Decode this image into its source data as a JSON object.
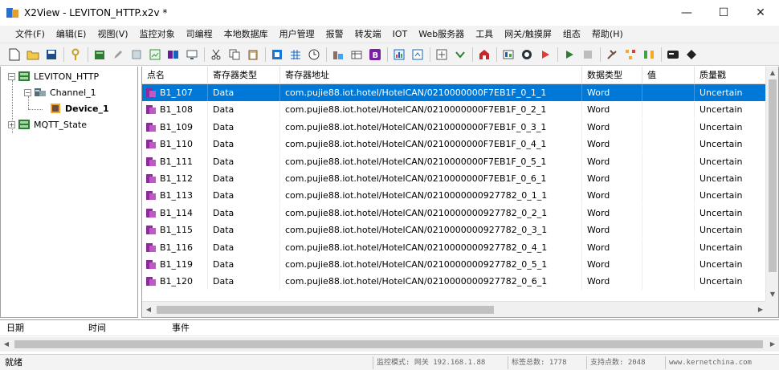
{
  "window": {
    "title": "X2View - LEVITON_HTTP.x2v *",
    "minimize_glyph": "—",
    "maximize_glyph": "☐",
    "close_glyph": "✕"
  },
  "menu": [
    "文件(F)",
    "编辑(E)",
    "视图(V)",
    "监控对象",
    "司编程",
    "本地数据库",
    "用户管理",
    "报警",
    "转发端",
    "IOT",
    "Web服务器",
    "工具",
    "网关/触摸屏",
    "组态",
    "帮助(H)"
  ],
  "toolbar": {
    "icons": [
      "new-file-icon",
      "open-folder-icon",
      "save-icon",
      "key-icon",
      "device-icon",
      "edit-icon",
      "list-icon",
      "chart-icon",
      "database-icon",
      "monitor-icon",
      "cut-icon",
      "copy-icon",
      "paste-icon",
      "import-icon",
      "grid-icon",
      "clock-icon",
      "tag-icon",
      "table-icon",
      "bold-b-icon",
      "report-icon",
      "sync-icon",
      "window-icon",
      "settings-icon",
      "home-icon",
      "image-icon",
      "web-icon",
      "play-red-icon",
      "play-green-icon",
      "stop-icon",
      "tools-icon",
      "branch-icon",
      "network-icon",
      "terminal-icon",
      "diamond-icon"
    ]
  },
  "tree": {
    "root": "LEVITON_HTTP",
    "channel": "Channel_1",
    "device": "Device_1",
    "mqtt": "MQTT_State",
    "collapse_glyph": "−",
    "expand_glyph": "+"
  },
  "grid": {
    "columns": [
      "点名",
      "寄存器类型",
      "寄存器地址",
      "数据类型",
      "值",
      "质量戳"
    ],
    "rows": [
      {
        "name": "B1_107",
        "reg_type": "Data",
        "address": "com.pujie88.iot.hotel/HotelCAN/0210000000F7EB1F_0_1_1",
        "data_type": "Word",
        "value": "",
        "quality": "Uncertain"
      },
      {
        "name": "B1_108",
        "reg_type": "Data",
        "address": "com.pujie88.iot.hotel/HotelCAN/0210000000F7EB1F_0_2_1",
        "data_type": "Word",
        "value": "",
        "quality": "Uncertain"
      },
      {
        "name": "B1_109",
        "reg_type": "Data",
        "address": "com.pujie88.iot.hotel/HotelCAN/0210000000F7EB1F_0_3_1",
        "data_type": "Word",
        "value": "",
        "quality": "Uncertain"
      },
      {
        "name": "B1_110",
        "reg_type": "Data",
        "address": "com.pujie88.iot.hotel/HotelCAN/0210000000F7EB1F_0_4_1",
        "data_type": "Word",
        "value": "",
        "quality": "Uncertain"
      },
      {
        "name": "B1_111",
        "reg_type": "Data",
        "address": "com.pujie88.iot.hotel/HotelCAN/0210000000F7EB1F_0_5_1",
        "data_type": "Word",
        "value": "",
        "quality": "Uncertain"
      },
      {
        "name": "B1_112",
        "reg_type": "Data",
        "address": "com.pujie88.iot.hotel/HotelCAN/0210000000F7EB1F_0_6_1",
        "data_type": "Word",
        "value": "",
        "quality": "Uncertain"
      },
      {
        "name": "B1_113",
        "reg_type": "Data",
        "address": "com.pujie88.iot.hotel/HotelCAN/0210000000927782_0_1_1",
        "data_type": "Word",
        "value": "",
        "quality": "Uncertain"
      },
      {
        "name": "B1_114",
        "reg_type": "Data",
        "address": "com.pujie88.iot.hotel/HotelCAN/0210000000927782_0_2_1",
        "data_type": "Word",
        "value": "",
        "quality": "Uncertain"
      },
      {
        "name": "B1_115",
        "reg_type": "Data",
        "address": "com.pujie88.iot.hotel/HotelCAN/0210000000927782_0_3_1",
        "data_type": "Word",
        "value": "",
        "quality": "Uncertain"
      },
      {
        "name": "B1_116",
        "reg_type": "Data",
        "address": "com.pujie88.iot.hotel/HotelCAN/0210000000927782_0_4_1",
        "data_type": "Word",
        "value": "",
        "quality": "Uncertain"
      },
      {
        "name": "B1_119",
        "reg_type": "Data",
        "address": "com.pujie88.iot.hotel/HotelCAN/0210000000927782_0_5_1",
        "data_type": "Word",
        "value": "",
        "quality": "Uncertain"
      },
      {
        "name": "B1_120",
        "reg_type": "Data",
        "address": "com.pujie88.iot.hotel/HotelCAN/0210000000927782_0_6_1",
        "data_type": "Word",
        "value": "",
        "quality": "Uncertain"
      }
    ],
    "selected_index": 0
  },
  "log": {
    "columns": [
      "日期",
      "时间",
      "事件"
    ]
  },
  "status": {
    "left": "就绪",
    "mode": "监控模式: 网关 192.168.1.88",
    "tag_total": "标签总数: 1778",
    "support_points": "支持点数: 2048",
    "website": "www.kernetchina.com"
  },
  "colors": {
    "selection": "#0078d7",
    "tag_icon": "#8a2c9a"
  }
}
